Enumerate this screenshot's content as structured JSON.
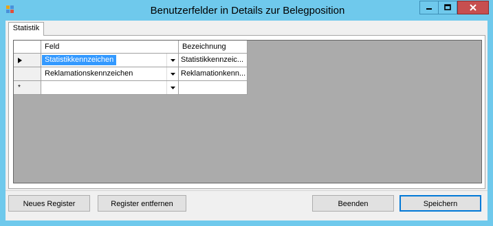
{
  "window": {
    "title": "Benutzerfelder in Details zur Belegposition",
    "icon": "app-icon",
    "controls": [
      "minimize-icon",
      "maximize-icon",
      "close-icon"
    ]
  },
  "tabs": [
    {
      "label": "Statistik",
      "active": true
    }
  ],
  "grid": {
    "columns": [
      "Feld",
      "Bezeichnung"
    ],
    "rows": [
      {
        "indicator": "current-row-icon",
        "feld": "Statistikkennzeichen",
        "bezeichnung": "Statistikkennzeic...",
        "selected": true
      },
      {
        "indicator": "",
        "feld": "Reklamationskennzeichen",
        "bezeichnung": "Reklamationkenn..."
      },
      {
        "indicator": "*",
        "feld": "",
        "bezeichnung": ""
      }
    ]
  },
  "buttons": {
    "new_tab": "Neues Register",
    "remove_tab": "Register entfernen",
    "close": "Beenden",
    "save": "Speichern"
  },
  "colors": {
    "titlebar": "#6fc9ec",
    "close_button": "#c74f4f",
    "selection": "#3399ff",
    "grid_background": "#ababab"
  }
}
